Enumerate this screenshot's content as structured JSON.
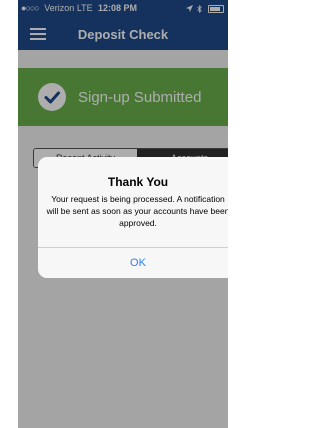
{
  "status_bar": {
    "signal_dots": "●○○○",
    "carrier": "Verizon",
    "network": "LTE",
    "time": "12:08 PM",
    "icons": [
      "location-icon",
      "bluetooth-icon",
      "battery-icon"
    ],
    "battery_level": 0.85
  },
  "nav": {
    "title": "Deposit Check",
    "menu_icon": "hamburger-menu-icon"
  },
  "banner": {
    "text": "Sign-up Submitted",
    "icon": "checkmark-icon",
    "color": "#6ab04c"
  },
  "tabs": [
    {
      "label": "Recent Activity",
      "selected": false
    },
    {
      "label": "Accounts",
      "selected": true
    }
  ],
  "alert": {
    "title": "Thank You",
    "message": "Your request is being processed. A notification will be sent as soon as your accounts have been approved.",
    "button": "OK"
  },
  "colors": {
    "nav_background": "#1e4b8a",
    "alert_button": "#2f7ef6"
  }
}
